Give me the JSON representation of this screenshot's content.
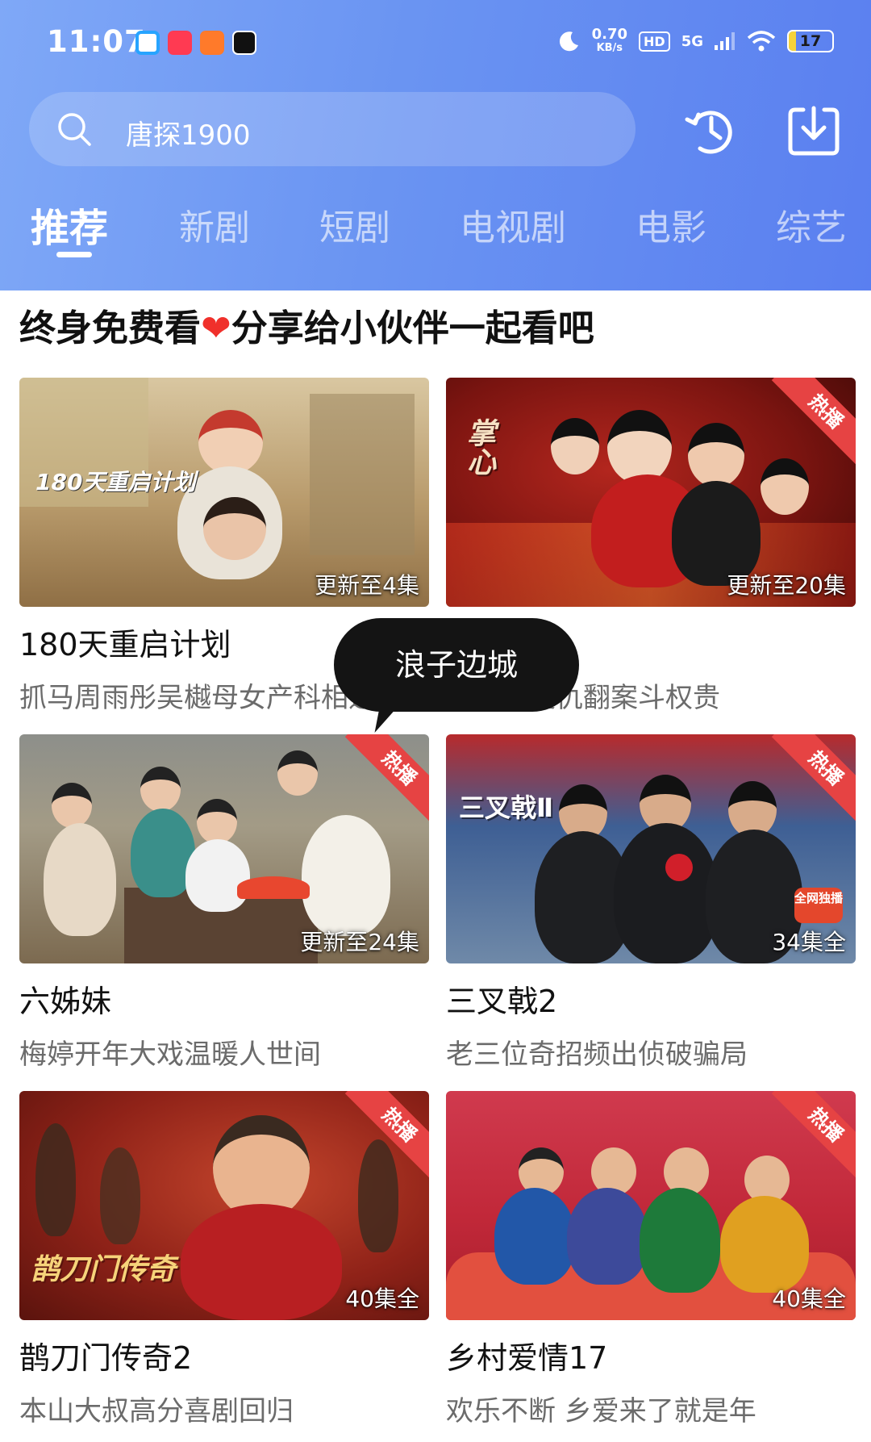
{
  "status_bar": {
    "time": "11:07",
    "net_speed_value": "0.70",
    "net_speed_unit": "KB/s",
    "hd": "HD",
    "network": "5G",
    "battery": "17",
    "battery_level": 0.17,
    "app_icons": [
      "app-icon-1",
      "app-icon-2",
      "app-icon-3",
      "capcut-icon"
    ]
  },
  "search": {
    "text": "唐探1900"
  },
  "header_icons": [
    "history-icon",
    "download-icon"
  ],
  "tabs": [
    {
      "label": "推荐",
      "active": true
    },
    {
      "label": "新剧",
      "active": false
    },
    {
      "label": "短剧",
      "active": false
    },
    {
      "label": "电视剧",
      "active": false
    },
    {
      "label": "电影",
      "active": false
    },
    {
      "label": "综艺",
      "active": false
    }
  ],
  "promo": {
    "text_a": "终身免费看",
    "heart": "❤",
    "text_b": "分享给小伙伴一起看吧"
  },
  "cards": [
    {
      "title": "180天重启计划",
      "subtitle": "抓马周雨彤吴樾母女产科相遇",
      "episodes": "更新至4集",
      "hot": false,
      "hot_label": "",
      "art_text": "180天重启计划"
    },
    {
      "title": "掌心",
      "subtitle": "刘诗诗复仇翻案斗权贵",
      "episodes": "更新至20集",
      "hot": true,
      "hot_label": "热播",
      "art_text": "掌心"
    },
    {
      "title": "六姊妹",
      "subtitle": "梅婷开年大戏温暖人世间",
      "episodes": "更新至24集",
      "hot": true,
      "hot_label": "热播",
      "art_text": ""
    },
    {
      "title": "三叉戟2",
      "subtitle": "老三位奇招频出侦破骗局",
      "episodes": "34集全",
      "hot": true,
      "hot_label": "热播",
      "art_text": "三叉戟Ⅱ",
      "badge": "全网独播"
    },
    {
      "title": "鹊刀门传奇2",
      "subtitle": "本山大叔高分喜剧回归",
      "episodes": "40集全",
      "hot": true,
      "hot_label": "热播",
      "art_text": "鹊刀门传奇"
    },
    {
      "title": "乡村爱情17",
      "subtitle": "欢乐不断 乡爱来了就是年",
      "episodes": "40集全",
      "hot": true,
      "hot_label": "热播",
      "art_text": ""
    }
  ],
  "tooltip": {
    "text": "浪子边城"
  },
  "colors": {
    "header_gradient_start": "#7fa8f7",
    "header_gradient_end": "#5a7ff0",
    "hot_ribbon": "#e64343",
    "heart": "#f0302b"
  }
}
